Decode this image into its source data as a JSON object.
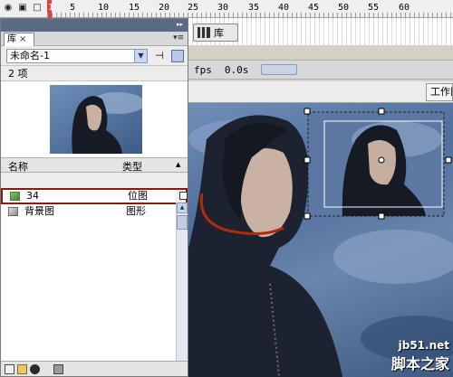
{
  "timeline": {
    "frame_numbers": [
      "1",
      "5",
      "10",
      "15",
      "20",
      "25",
      "30",
      "35",
      "40",
      "45",
      "50",
      "55",
      "60"
    ]
  },
  "library_tab_button": {
    "label": "库"
  },
  "status": {
    "fps": "fps",
    "time": "0.0s"
  },
  "work_area": {
    "label": "工作区"
  },
  "library": {
    "tab_label": "库",
    "tab_close": "×",
    "document": "未命名-1",
    "item_count": "2 项",
    "columns": {
      "name": "名称",
      "type": "类型"
    },
    "items": [
      {
        "name": "34",
        "type": "位图",
        "icon": "bitmap-icon"
      },
      {
        "name": "背景图",
        "type": "图形",
        "icon": "graphic-symbol-icon"
      }
    ]
  },
  "watermark": {
    "line1": "jb51.net",
    "line2": "脚本之家"
  },
  "colors": {
    "panel_header": "#5a6b86",
    "highlight_border": "#8a1a10",
    "playhead": "#e04040",
    "annotation_stroke": "#b02a10"
  }
}
